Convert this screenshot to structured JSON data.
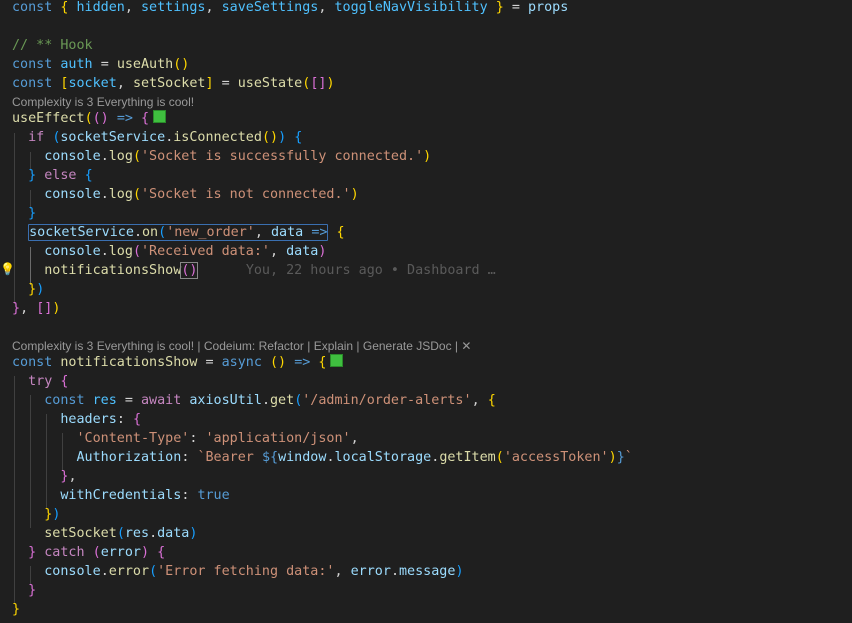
{
  "editor": {
    "code_lens_1": "Complexity is 3 Everything is cool!",
    "code_lens_2": {
      "complexity": "Complexity is 3 Everything is cool!",
      "codeium_refactor": "Codeium: Refactor",
      "explain": "Explain",
      "generate_jsdoc": "Generate JSDoc",
      "close": "✕"
    },
    "blame": "You, 22 hours ago • Dashboard …",
    "lines": {
      "l1": {
        "t1": "const",
        "t2": "{",
        "t3": "hidden",
        "t4": "settings",
        "t5": "saveSettings",
        "t6": "toggleNavVisibility",
        "t7": "}",
        "t8": "=",
        "t9": "props"
      },
      "l3": "// ** Hook",
      "l4": {
        "t1": "const",
        "t2": "auth",
        "t3": "=",
        "t4": "useAuth",
        "t5": "()"
      },
      "l5": {
        "t1": "const",
        "t2": "[",
        "t3": "socket",
        "t4": "setSocket",
        "t5": "]",
        "t6": "=",
        "t7": "useState",
        "t8": "(",
        "t9": "[]",
        "t10": ")"
      },
      "l6": {
        "t1": "useEffect",
        "t2": "(",
        "t3": "()",
        "t4": "=>",
        "t5": "{"
      },
      "l7": {
        "t1": "if",
        "t2": "(",
        "t3": "socketService",
        "t4": "isConnected",
        "t5": "()",
        "t6": ")",
        "t7": "{"
      },
      "l8": {
        "t1": "console",
        "t2": "log",
        "t3": "(",
        "t4": "'Socket is successfully connected.'",
        "t5": ")"
      },
      "l9": {
        "t1": "}",
        "t2": "else",
        "t3": "{"
      },
      "l10": {
        "t1": "console",
        "t2": "log",
        "t3": "(",
        "t4": "'Socket is not connected.'",
        "t5": ")"
      },
      "l11": "}",
      "l12": {
        "t1": "socketService",
        "t2": "on",
        "t3": "(",
        "t4": "'new_order'",
        "t5": "data",
        "t6": "=>",
        "t7": "{"
      },
      "l13": {
        "t1": "console",
        "t2": "log",
        "t3": "(",
        "t4": "'Received data:'",
        "t5": "data",
        "t6": ")"
      },
      "l14": {
        "t1": "notificationsShow",
        "t2": "()"
      },
      "l15": {
        "t1": "}",
        "t2": ")"
      },
      "l16": {
        "t1": "}",
        "t2": "[]",
        "t3": ")"
      },
      "l18": {
        "t1": "const",
        "t2": "notificationsShow",
        "t3": "=",
        "t4": "async",
        "t5": "()",
        "t6": "=>",
        "t7": "{"
      },
      "l19": {
        "t1": "try",
        "t2": "{"
      },
      "l20": {
        "t1": "const",
        "t2": "res",
        "t3": "=",
        "t4": "await",
        "t5": "axiosUtil",
        "t6": "get",
        "t7": "(",
        "t8": "'/admin/order-alerts'",
        "t9": "{"
      },
      "l21": {
        "t1": "headers",
        "t2": "{"
      },
      "l22": {
        "t1": "'Content-Type'",
        "t2": "'application/json'"
      },
      "l23": {
        "t1": "Authorization",
        "t2": "`Bearer ",
        "t3": "${",
        "t4": "window",
        "t5": "localStorage",
        "t6": "getItem",
        "t7": "(",
        "t8": "'accessToken'",
        "t9": ")",
        "t10": "}",
        "t11": "`"
      },
      "l24": {
        "t1": "}",
        "t2": ","
      },
      "l25": {
        "t1": "withCredentials",
        "t2": "true"
      },
      "l26": {
        "t1": "}",
        "t2": ")"
      },
      "l27": {
        "t1": "setSocket",
        "t2": "(",
        "t3": "res",
        "t4": "data",
        "t5": ")"
      },
      "l28": {
        "t1": "}",
        "t2": "catch",
        "t3": "(",
        "t4": "error",
        "t5": ")",
        "t6": "{"
      },
      "l29": {
        "t1": "console",
        "t2": "error",
        "t3": "(",
        "t4": "'Error fetching data:'",
        "t5": "error",
        "t6": "message",
        "t7": ")"
      },
      "l30": "}",
      "l31": "}"
    }
  },
  "colors": {
    "background": "#1f1f1f",
    "keyword": "#569cd6",
    "control": "#c586c0",
    "variable": "#9cdcfe",
    "function": "#dcdcaa",
    "string": "#ce9178",
    "comment": "#6a9955",
    "bracket_gold": "#ffd700",
    "bracket_purple": "#da70d6",
    "bracket_blue": "#179fff"
  },
  "icons": {
    "lightbulb": "lightbulb-icon",
    "complexity_badge": "complexity-badge-icon",
    "close": "close-icon"
  }
}
